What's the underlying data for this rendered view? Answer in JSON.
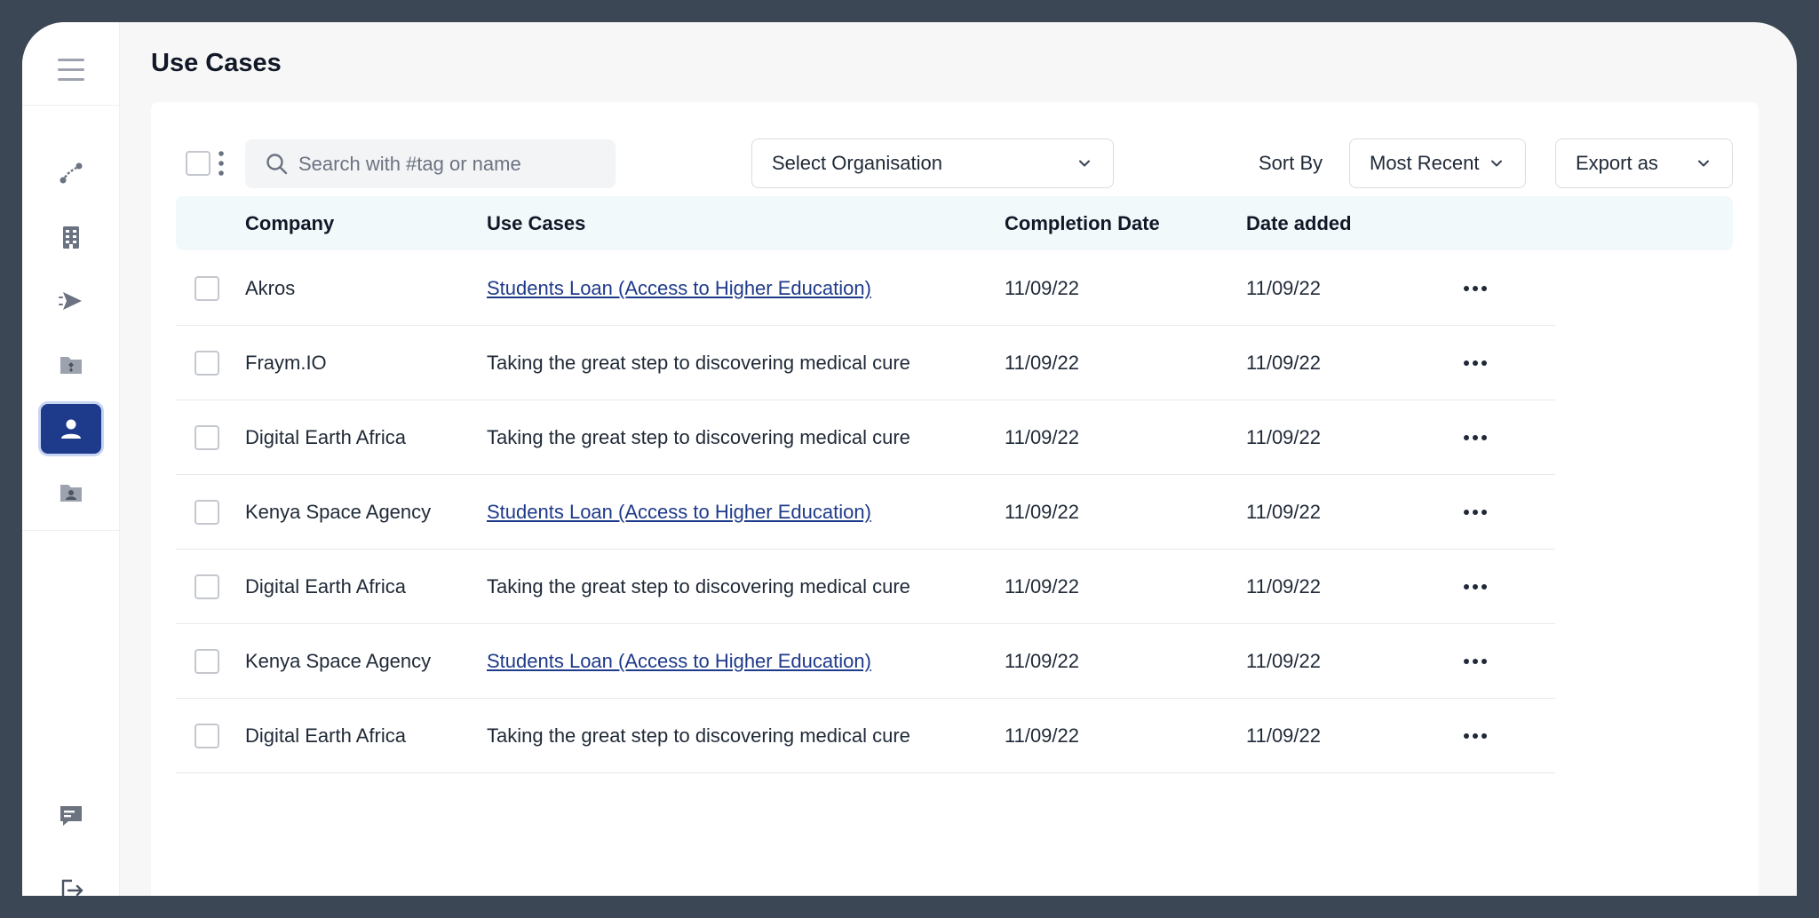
{
  "page": {
    "title": "Use Cases"
  },
  "sidebar": {
    "items": [
      {
        "icon": "route-icon"
      },
      {
        "icon": "building-icon"
      },
      {
        "icon": "send-icon"
      },
      {
        "icon": "folder-icon"
      },
      {
        "icon": "user-icon",
        "active": true
      },
      {
        "icon": "contact-card-icon"
      }
    ],
    "bottom": [
      {
        "icon": "chat-icon"
      },
      {
        "icon": "logout-icon"
      }
    ]
  },
  "toolbar": {
    "search_placeholder": "Search with #tag or name",
    "organisation_select": "Select Organisation",
    "sort_label": "Sort By",
    "sort_value": "Most Recent",
    "export_label": "Export as"
  },
  "table": {
    "headers": {
      "company": "Company",
      "use_case": "Use Cases",
      "completion_date": "Completion Date",
      "date_added": "Date added"
    },
    "rows": [
      {
        "company": "Akros",
        "use_case": "Students Loan (Access to Higher Education)",
        "completion_date": "11/09/22",
        "date_added": "11/09/22",
        "link": true
      },
      {
        "company": "Fraym.IO",
        "use_case": "Taking the great step to discovering medical cure",
        "completion_date": "11/09/22",
        "date_added": "11/09/22",
        "link": false
      },
      {
        "company": "Digital Earth Africa",
        "use_case": "Taking the great step to discovering medical cure",
        "completion_date": "11/09/22",
        "date_added": "11/09/22",
        "link": false
      },
      {
        "company": "Kenya Space Agency",
        "use_case": "Students Loan (Access to Higher Education)",
        "completion_date": "11/09/22",
        "date_added": "11/09/22",
        "link": true
      },
      {
        "company": "Digital Earth Africa",
        "use_case": "Taking the great step to discovering medical cure",
        "completion_date": "11/09/22",
        "date_added": "11/09/22",
        "link": false
      },
      {
        "company": "Kenya Space Agency",
        "use_case": "Students Loan (Access to Higher Education)",
        "completion_date": "11/09/22",
        "date_added": "11/09/22",
        "link": true
      },
      {
        "company": "Digital Earth Africa",
        "use_case": "Taking the great step to discovering medical cure",
        "completion_date": "11/09/22",
        "date_added": "11/09/22",
        "link": false
      }
    ]
  },
  "colors": {
    "primary": "#1e3a8a",
    "frame": "#3b4755",
    "header_bg": "#f2f9fb",
    "icon_gray": "#6b7280"
  }
}
